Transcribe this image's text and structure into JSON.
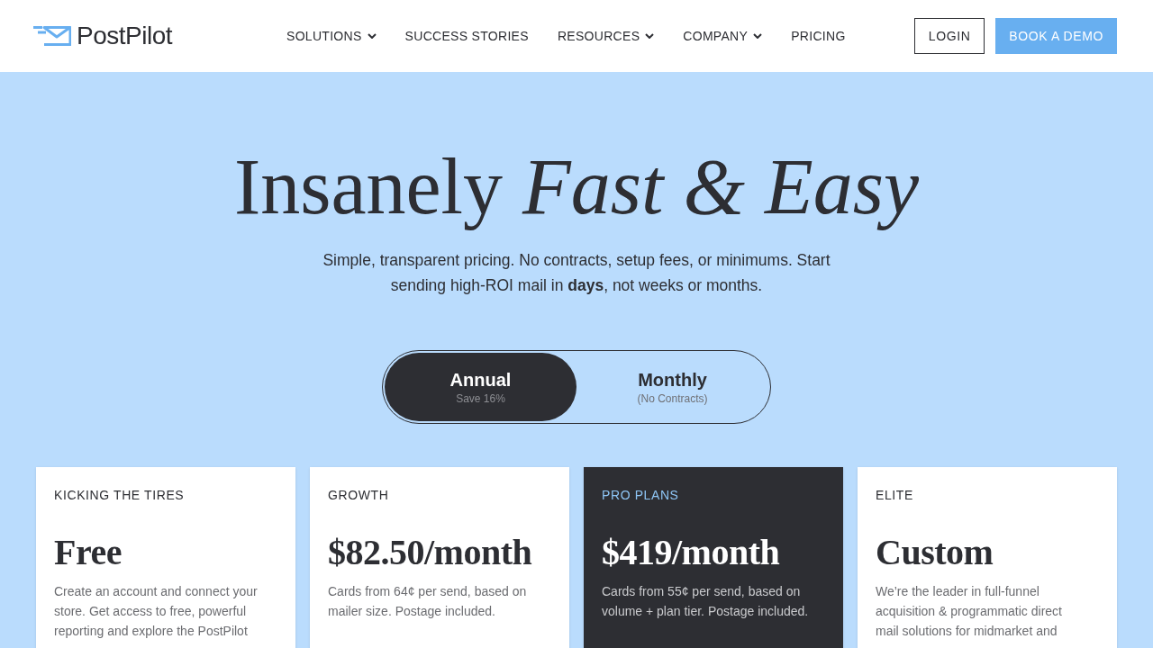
{
  "header": {
    "logo": {
      "text": "PostPilot"
    },
    "nav": [
      {
        "label": "SOLUTIONS",
        "dropdown": true
      },
      {
        "label": "SUCCESS STORIES",
        "dropdown": false
      },
      {
        "label": "RESOURCES",
        "dropdown": true
      },
      {
        "label": "COMPANY",
        "dropdown": true
      },
      {
        "label": "PRICING",
        "dropdown": false
      }
    ],
    "actions": [
      {
        "label": "LOGIN",
        "kind": "outline"
      },
      {
        "label": "BOOK A DEMO",
        "kind": "primary"
      }
    ]
  },
  "hero": {
    "title": "Insanely *Fast & Easy*",
    "subtitle": "Simple, transparent pricing. No contracts, setup fees, or minimums. Start sending high-ROI mail in **days**, not weeks or months."
  },
  "billing_toggle": [
    {
      "label": "Annual",
      "note": "Save 16%",
      "selected": true
    },
    {
      "label": "Monthly",
      "note": "(No Contracts)",
      "selected": false
    }
  ],
  "plans": [
    {
      "name": "KICKING THE TIRES",
      "price": "Free",
      "description": "Create an account and connect your store. Get access to free, powerful reporting and explore the PostPilot",
      "featured": false
    },
    {
      "name": "GROWTH",
      "price": "$82.50/month",
      "description": "Cards from 64¢ per send, based on mailer size. Postage included.",
      "featured": false
    },
    {
      "name": "PRO PLANS",
      "price": "$419/month",
      "description": "Cards from 55¢ per send, based on volume + plan tier. Postage included.",
      "featured": true
    },
    {
      "name": "ELITE",
      "price": "Custom",
      "description": "We’re the leader in full-funnel acquisition & programmatic direct mail solutions for midmarket and",
      "featured": false
    }
  ]
}
